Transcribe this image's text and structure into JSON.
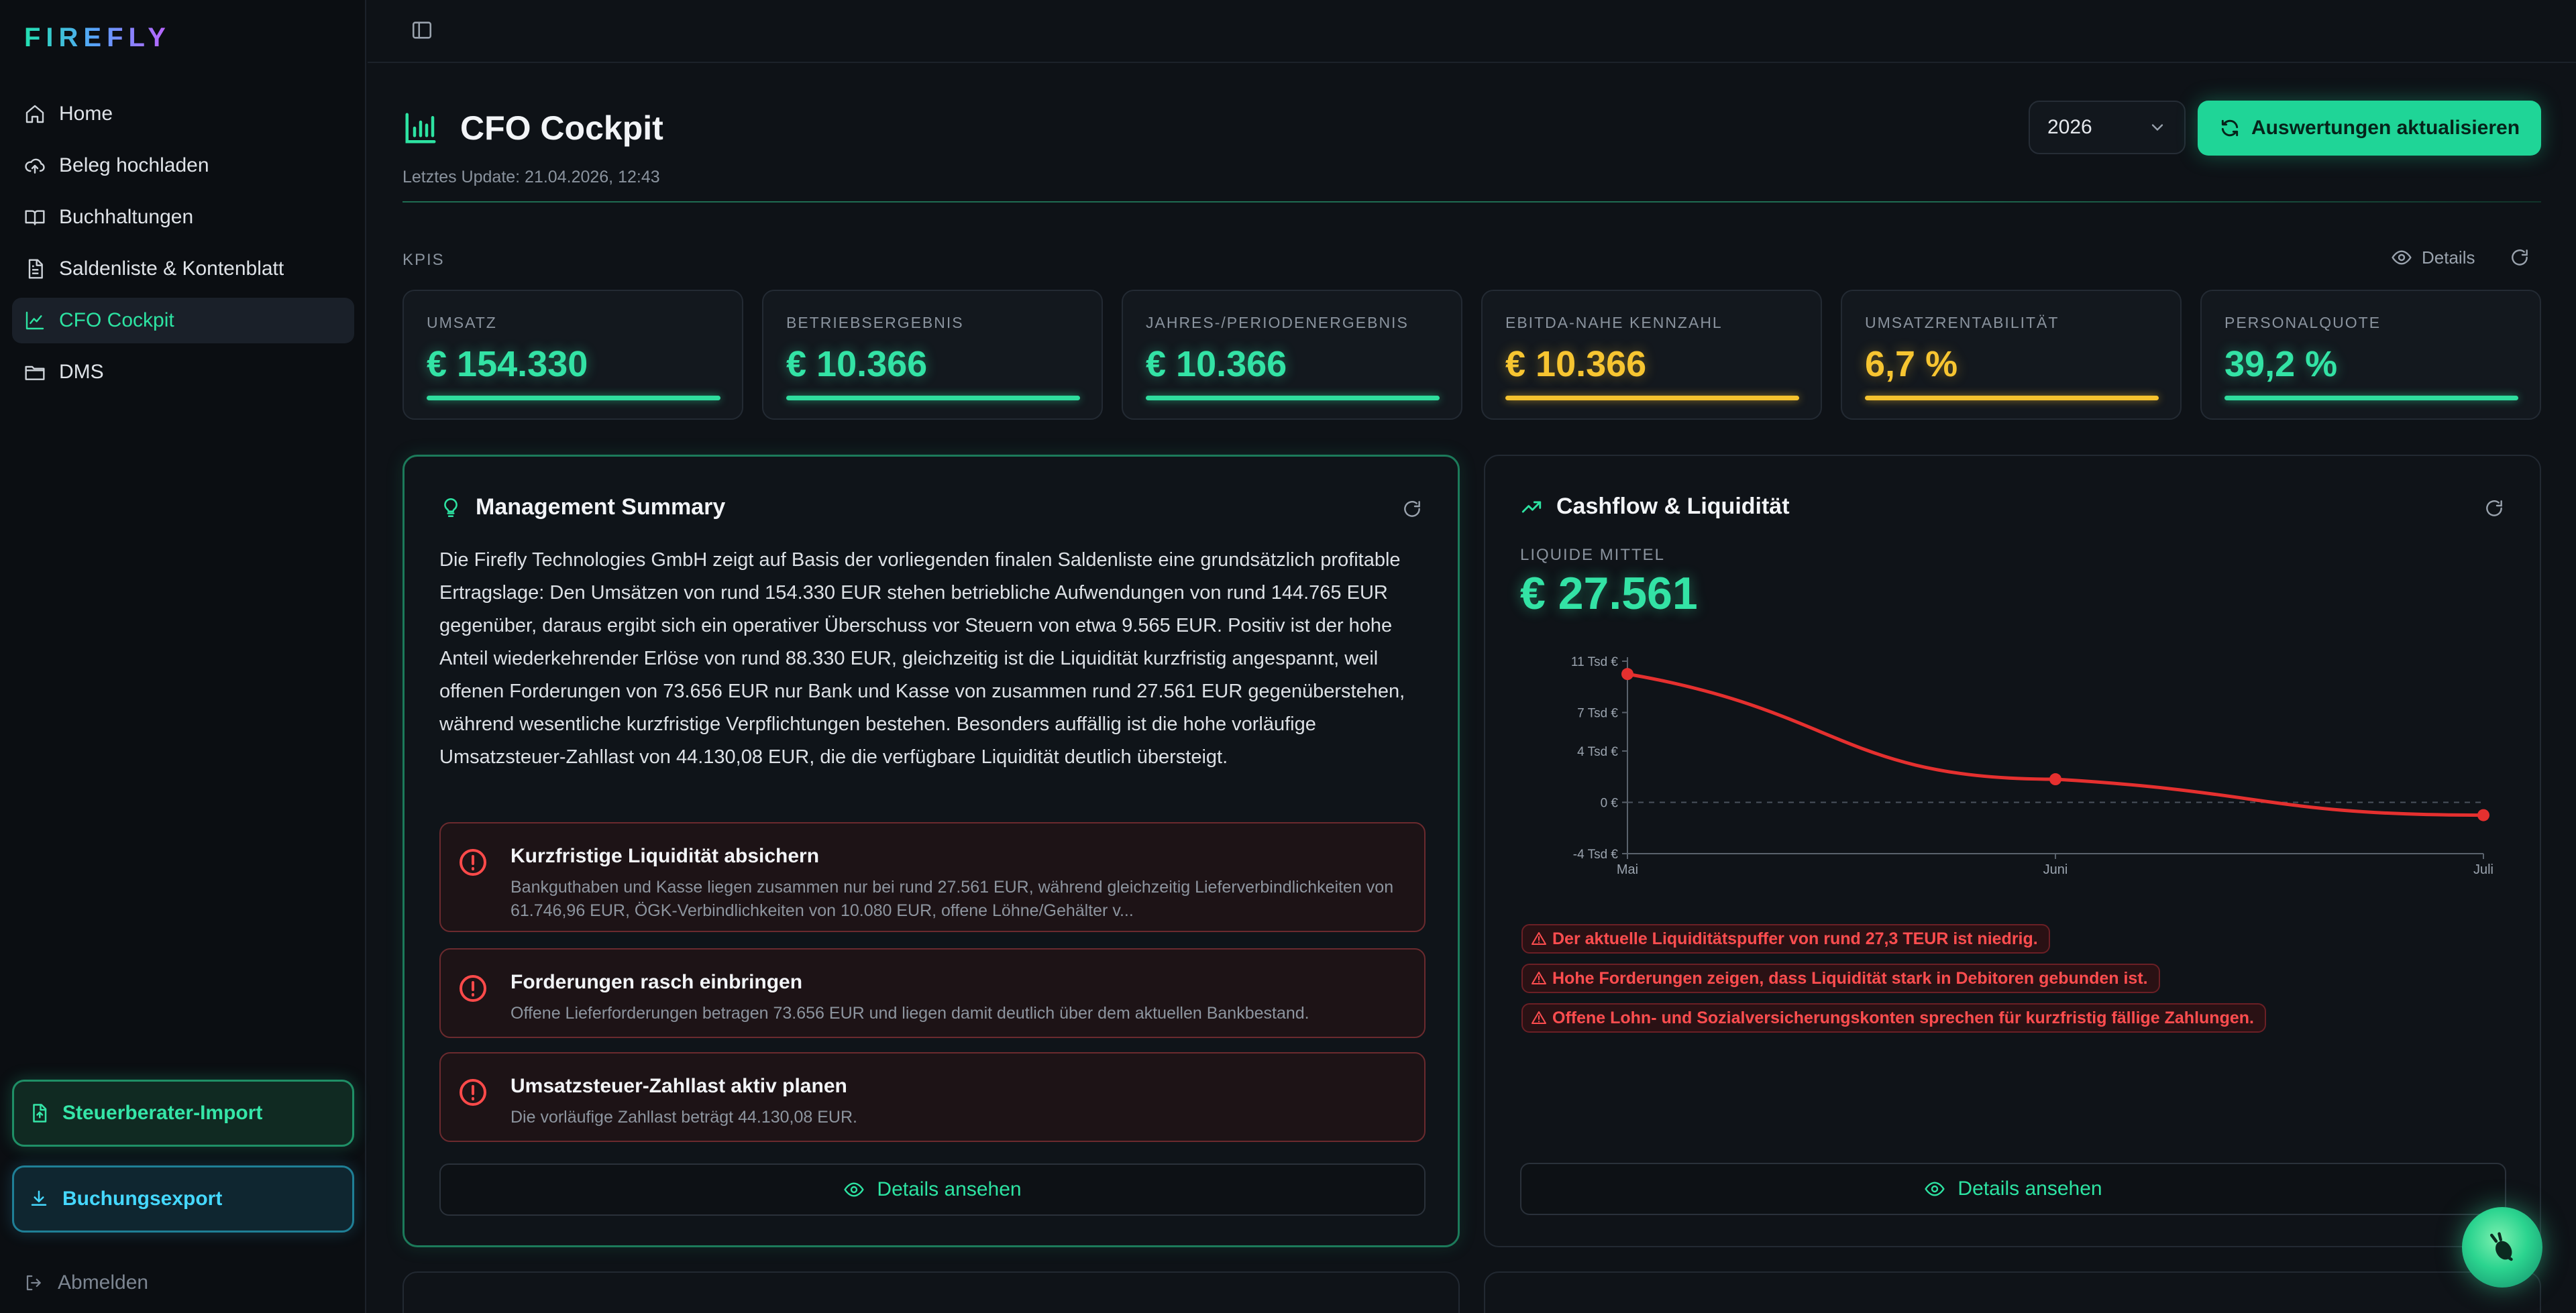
{
  "app": {
    "logo": "FIREFLY"
  },
  "sidebar": {
    "items": [
      {
        "label": "Home",
        "icon": "home-icon"
      },
      {
        "label": "Beleg hochladen",
        "icon": "cloud-upload-icon"
      },
      {
        "label": "Buchhaltungen",
        "icon": "book-icon"
      },
      {
        "label": "Saldenliste & Kontenblatt",
        "icon": "file-list-icon"
      },
      {
        "label": "CFO Cockpit",
        "icon": "line-chart-icon",
        "active": true
      },
      {
        "label": "DMS",
        "icon": "folder-icon"
      }
    ],
    "import_label": "Steuerberater-Import",
    "export_label": "Buchungsexport",
    "logout_label": "Abmelden"
  },
  "header": {
    "title": "CFO Cockpit",
    "last_update": "Letztes Update: 21.04.2026, 12:43",
    "year": "2026",
    "refresh_label": "Auswertungen aktualisieren"
  },
  "kpis": {
    "section_label": "KPIS",
    "details_label": "Details",
    "items": [
      {
        "label": "UMSATZ",
        "value": "€ 154.330",
        "tone": "green"
      },
      {
        "label": "BETRIEBSERGEBNIS",
        "value": "€ 10.366",
        "tone": "green"
      },
      {
        "label": "JAHRES-/PERIODENERGEBNIS",
        "value": "€ 10.366",
        "tone": "green"
      },
      {
        "label": "EBITDA-NAHE KENNZAHL",
        "value": "€ 10.366",
        "tone": "yellow"
      },
      {
        "label": "UMSATZRENTABILITÄT",
        "value": "6,7 %",
        "tone": "yellow"
      },
      {
        "label": "PERSONALQUOTE",
        "value": "39,2 %",
        "tone": "green"
      }
    ]
  },
  "management": {
    "title": "Management Summary",
    "summary": "Die Firefly Technologies GmbH zeigt auf Basis der vorliegenden finalen Saldenliste eine grundsätzlich profitable Ertragslage: Den Umsätzen von rund 154.330 EUR stehen betriebliche Aufwendungen von rund 144.765 EUR gegenüber, daraus ergibt sich ein operativer Überschuss vor Steuern von etwa 9.565 EUR. Positiv ist der hohe Anteil wiederkehrender Erlöse von rund 88.330 EUR, gleichzeitig ist die Liquidität kurzfristig angespannt, weil offenen Forderungen von 73.656 EUR nur Bank und Kasse von zusammen rund 27.561 EUR gegenüberstehen, während wesentliche kurzfristige Verpflichtungen bestehen. Besonders auffällig ist die hohe vorläufige Umsatzsteuer-Zahllast von 44.130,08 EUR, die die verfügbare Liquidität deutlich übersteigt.",
    "alerts": [
      {
        "title": "Kurzfristige Liquidität absichern",
        "text": "Bankguthaben und Kasse liegen zusammen nur bei rund 27.561 EUR, während gleichzeitig Lieferverbindlichkeiten von 61.746,96 EUR, ÖGK-Verbindlichkeiten von 10.080 EUR, offene Löhne/Gehälter v..."
      },
      {
        "title": "Forderungen rasch einbringen",
        "text": "Offene Lieferforderungen betragen 73.656 EUR und liegen damit deutlich über dem aktuellen Bankbestand."
      },
      {
        "title": "Umsatzsteuer-Zahllast aktiv planen",
        "text": "Die vorläufige Zahllast beträgt 44.130,08 EUR."
      }
    ],
    "details_label": "Details ansehen"
  },
  "cashflow": {
    "title": "Cashflow & Liquidität",
    "liquid_label": "LIQUIDE MITTEL",
    "liquid_value": "€ 27.561",
    "warnings": [
      "Der aktuelle Liquiditätspuffer von rund 27,3 TEUR ist niedrig.",
      "Hohe Forderungen zeigen, dass Liquidität stark in Debitoren gebunden ist.",
      "Offene Lohn- und Sozialversicherungskonten sprechen für kurzfristig fällige Zahlungen."
    ],
    "details_label": "Details ansehen"
  },
  "chart_data": {
    "type": "line",
    "categories": [
      "Mai",
      "Juni",
      "Juli"
    ],
    "series": [
      {
        "values": [
          10.0,
          1.8,
          -1.0
        ],
        "color": "#e5302f"
      }
    ],
    "ylim": [
      -4,
      11
    ],
    "yticks": [
      11,
      7,
      4,
      0,
      -4
    ],
    "ytick_labels": [
      "11 Tsd €",
      "7 Tsd €",
      "4 Tsd €",
      "0 €",
      "-4 Tsd €"
    ],
    "title": "",
    "xlabel": "",
    "ylabel": ""
  },
  "colors": {
    "accent": "#2de3a2",
    "warning": "#f5c22e",
    "danger": "#e5302f"
  }
}
